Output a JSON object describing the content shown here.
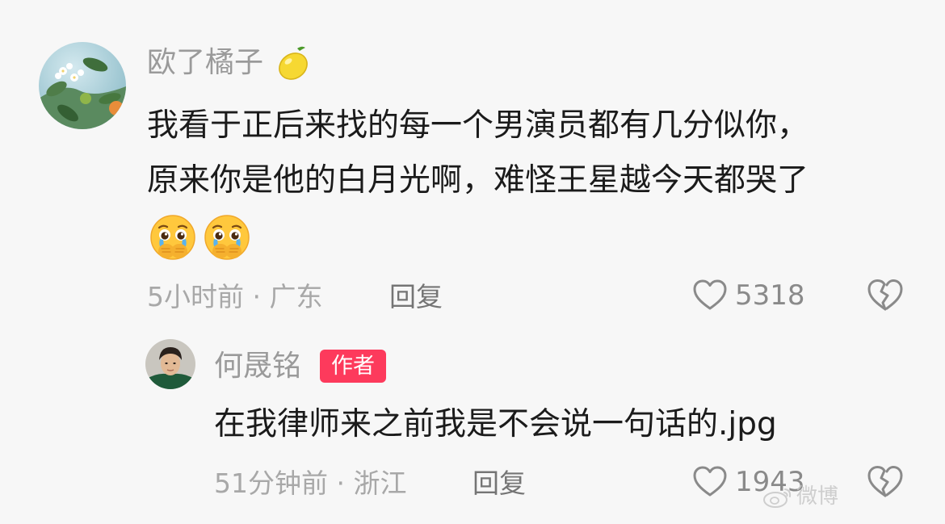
{
  "comments": [
    {
      "username": "欧了橘子",
      "text_lines": [
        "我看于正后来找的每一个男演员都有几分似你，",
        "原来你是他的白月光啊，难怪王星越今天都哭了"
      ],
      "emoji": [
        "crying-face-hands-over-mouth",
        "crying-face-hands-over-mouth"
      ],
      "time": "5小时前",
      "separator": " · ",
      "location": "广东",
      "reply_label": "回复",
      "likes": "5318"
    },
    {
      "username": "何晟铭",
      "badge": "作者",
      "text": "在我律师来之前我是不会说一句话的.jpg",
      "time": "51分钟前",
      "separator": " · ",
      "location": "浙江",
      "reply_label": "回复",
      "likes": "1943"
    }
  ],
  "icons": {
    "like": "heart-outline-icon",
    "dislike": "broken-heart-icon",
    "name_suffix": "lemon-icon"
  },
  "colors": {
    "background": "#f7f7f7",
    "text": "#1b1b1b",
    "meta": "#a8a8a8",
    "author_badge": "#fd3a5c"
  },
  "watermark": "微博"
}
